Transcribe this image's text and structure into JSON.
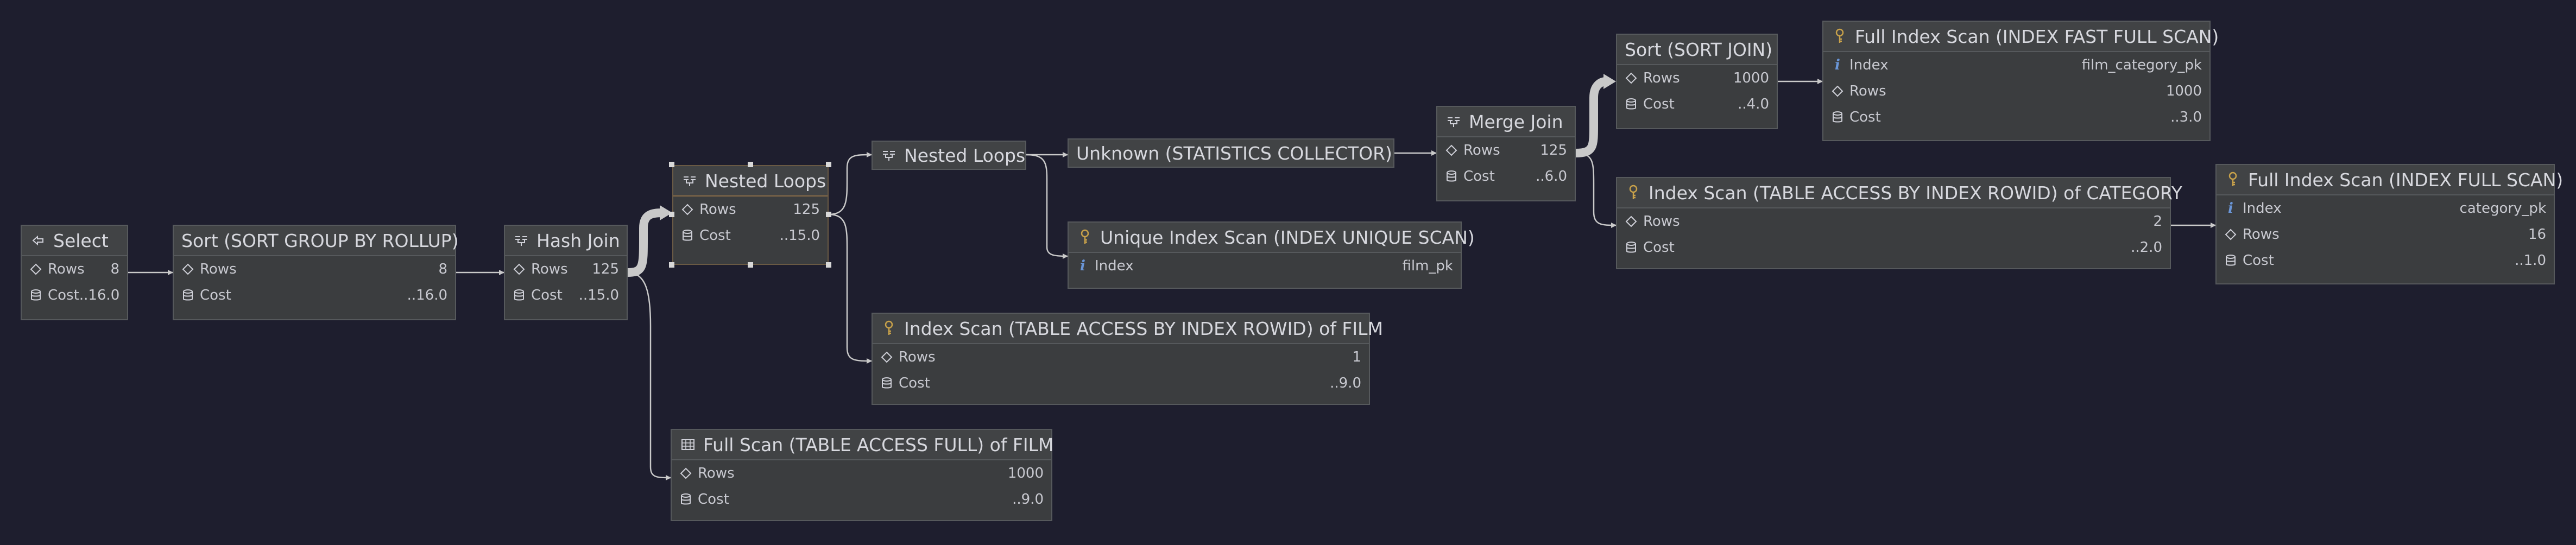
{
  "colors": {
    "background": "#1e1e2e",
    "node_fill": "#3b3d3f",
    "node_border": "#56595c",
    "edge": "#c9c9c9",
    "key_icon": "#c9a24a",
    "info_icon": "#6a96d8"
  },
  "nodes": {
    "select": {
      "title": "Select",
      "rows_label": "Rows",
      "rows": "8",
      "cost_label": "Cost",
      "cost": "..16.0"
    },
    "sort_rollup": {
      "title": "Sort (SORT GROUP BY ROLLUP)",
      "rows_label": "Rows",
      "rows": "8",
      "cost_label": "Cost",
      "cost": "..16.0"
    },
    "hash_join": {
      "title": "Hash Join",
      "rows_label": "Rows",
      "rows": "125",
      "cost_label": "Cost",
      "cost": "..15.0"
    },
    "nested_loops_1": {
      "title": "Nested Loops",
      "rows_label": "Rows",
      "rows": "125",
      "cost_label": "Cost",
      "cost": "..15.0"
    },
    "nested_loops_2": {
      "title": "Nested Loops"
    },
    "unknown_stats": {
      "title": "Unknown (STATISTICS COLLECTOR)"
    },
    "merge_join": {
      "title": "Merge Join",
      "rows_label": "Rows",
      "rows": "125",
      "cost_label": "Cost",
      "cost": "..6.0"
    },
    "sort_join": {
      "title": "Sort (SORT JOIN)",
      "rows_label": "Rows",
      "rows": "1000",
      "cost_label": "Cost",
      "cost": "..4.0"
    },
    "full_index_fast": {
      "title": "Full Index Scan (INDEX FAST FULL SCAN)",
      "index_label": "Index",
      "index": "film_category_pk",
      "rows_label": "Rows",
      "rows": "1000",
      "cost_label": "Cost",
      "cost": "..3.0"
    },
    "index_scan_category": {
      "title": "Index Scan (TABLE ACCESS BY INDEX ROWID) of CATEGORY",
      "rows_label": "Rows",
      "rows": "2",
      "cost_label": "Cost",
      "cost": "..2.0"
    },
    "full_index_scan": {
      "title": "Full Index Scan (INDEX FULL SCAN)",
      "index_label": "Index",
      "index": "category_pk",
      "rows_label": "Rows",
      "rows": "16",
      "cost_label": "Cost",
      "cost": "..1.0"
    },
    "unique_index": {
      "title": "Unique Index Scan (INDEX UNIQUE SCAN)",
      "index_label": "Index",
      "index": "film_pk"
    },
    "index_scan_film": {
      "title": "Index Scan (TABLE ACCESS BY INDEX ROWID) of FILM",
      "rows_label": "Rows",
      "rows": "1",
      "cost_label": "Cost",
      "cost": "..9.0"
    },
    "full_scan_film": {
      "title": "Full Scan (TABLE ACCESS FULL) of FILM",
      "rows_label": "Rows",
      "rows": "1000",
      "cost_label": "Cost",
      "cost": "..9.0"
    }
  }
}
